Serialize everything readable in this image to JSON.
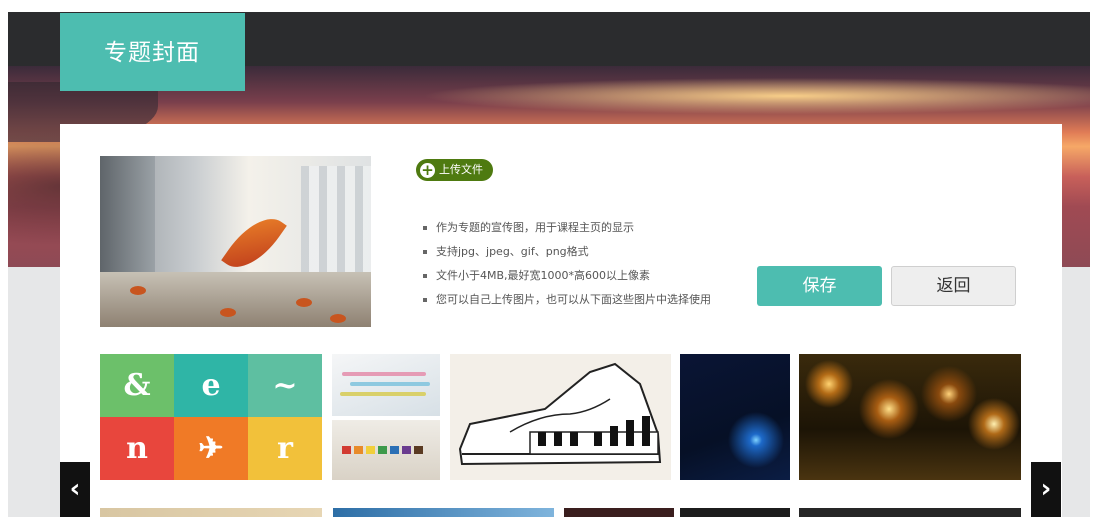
{
  "header": {
    "title": "专题封面"
  },
  "upload": {
    "label": "上传文件"
  },
  "tips": [
    "作为专题的宣传图，用于课程主页的显示",
    "支持jpg、jpeg、gif、png格式",
    "文件小于4MB,最好宽1000*高600以上像素",
    "您可以自己上传图片，也可以从下面这些图片中选择使用"
  ],
  "actions": {
    "save_label": "保存",
    "back_label": "返回"
  },
  "nav": {
    "prev_icon": "chevron-left-icon",
    "next_icon": "chevron-right-icon"
  },
  "colors": {
    "accent": "#4dbdb0",
    "upload": "#4e7a10",
    "header_bar": "#2b2c2e"
  }
}
